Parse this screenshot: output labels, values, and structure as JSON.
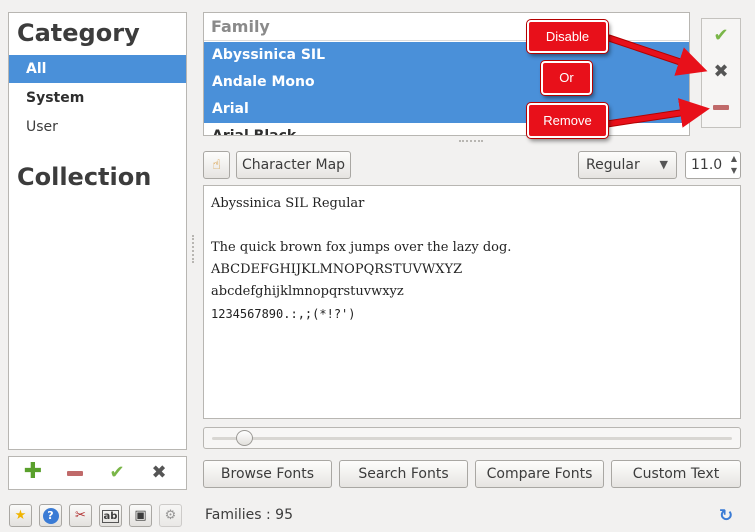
{
  "category_panel": {
    "heading": "Category",
    "items": [
      {
        "label": "All",
        "selected": true
      },
      {
        "label": "System",
        "bold": true
      },
      {
        "label": "User"
      }
    ],
    "collection_heading": "Collection"
  },
  "family_list": {
    "header": "Family",
    "rows": [
      "Abyssinica SIL",
      "Andale Mono",
      "Arial",
      "Arial Black"
    ]
  },
  "actions": {
    "enable_icon": "check-icon",
    "disable_icon": "x-icon",
    "remove_icon": "minus-icon"
  },
  "toolbar": {
    "character_map_label": "Character Map",
    "style_value": "Regular",
    "size_value": "11.0"
  },
  "preview": {
    "lines": [
      "Abyssinica SIL Regular",
      "",
      "The quick brown fox jumps over the lazy dog.",
      "ABCDEFGHIJKLMNOPQRSTUVWXYZ",
      "abcdefghijklmnopqrstuvwxyz",
      "1234567890.:,;(*!?')"
    ]
  },
  "tabs": {
    "browse": "Browse Fonts",
    "search": "Search Fonts",
    "compare": "Compare Fonts",
    "custom": "Custom Text"
  },
  "status": {
    "families": "Families : 95"
  },
  "annotations": {
    "disable": "Disable",
    "or": "Or",
    "remove": "Remove"
  },
  "colors": {
    "selection": "#4a90d9",
    "callout": "#e8101a",
    "enable_green": "#7ab648"
  }
}
